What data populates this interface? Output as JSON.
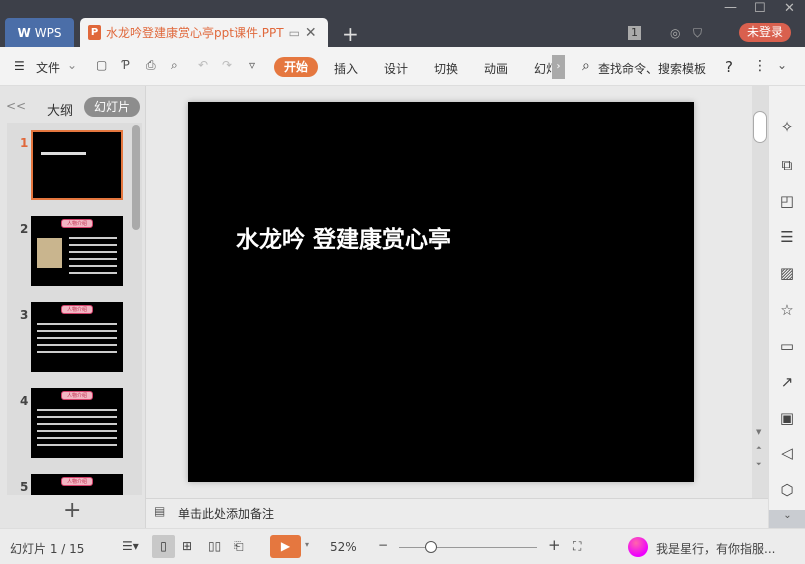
{
  "titlebar": {
    "wps_label": "WPS",
    "doc_tab": "水龙吟登建康赏心亭ppt课件.PPT",
    "new_tab": "+",
    "minimize": "—",
    "maximize": "☐",
    "close": "✕",
    "login": "未登录",
    "badge": "1"
  },
  "toolbar": {
    "menu": "文件",
    "tabs": [
      "开始",
      "插入",
      "设计",
      "切换",
      "动画",
      "幻灯"
    ],
    "search": "查找命令、搜索模板",
    "help": "?"
  },
  "left_panel": {
    "collapse": "<<",
    "outline_tab": "大纲",
    "slides_tab": "幻灯片",
    "add": "+",
    "thumbs": [
      {
        "num": "1",
        "badge": ""
      },
      {
        "num": "2",
        "badge": "人物介绍"
      },
      {
        "num": "3",
        "badge": "人物介绍"
      },
      {
        "num": "4",
        "badge": "人物介绍"
      },
      {
        "num": "5",
        "badge": "人物介绍"
      }
    ]
  },
  "slide": {
    "title": "水龙吟 登建康赏心亭"
  },
  "notes": {
    "placeholder": "单击此处添加备注"
  },
  "status": {
    "slide_counter": "幻灯片 1 / 15",
    "zoom": "52%",
    "assistant": "我是星行，有你指服..."
  },
  "colors": {
    "accent": "#e5773f",
    "titlebar": "#3d4049",
    "wps_blue": "#4b6ea8",
    "login": "#d9604e"
  }
}
